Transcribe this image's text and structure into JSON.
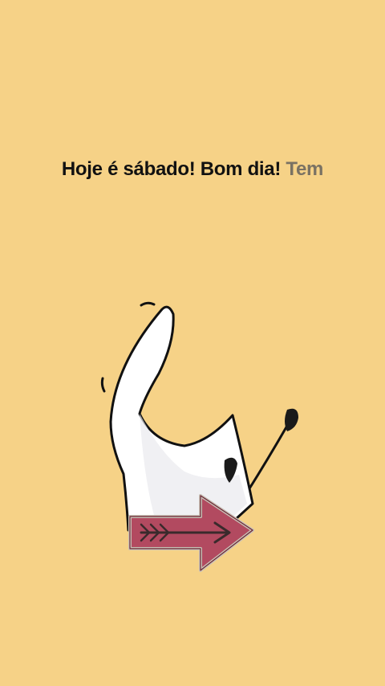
{
  "caption": {
    "spoken": "Hoje é sábado! Bom dia!",
    "upcoming": "Tem"
  },
  "sticker": {
    "icon": "white-character-with-arrow-sticker",
    "arrow_icon": "right-arrow-icon",
    "colors": {
      "background": "#f6d287",
      "body": "#ffffff",
      "outline": "#111111",
      "arrow": "#b24a60"
    }
  }
}
